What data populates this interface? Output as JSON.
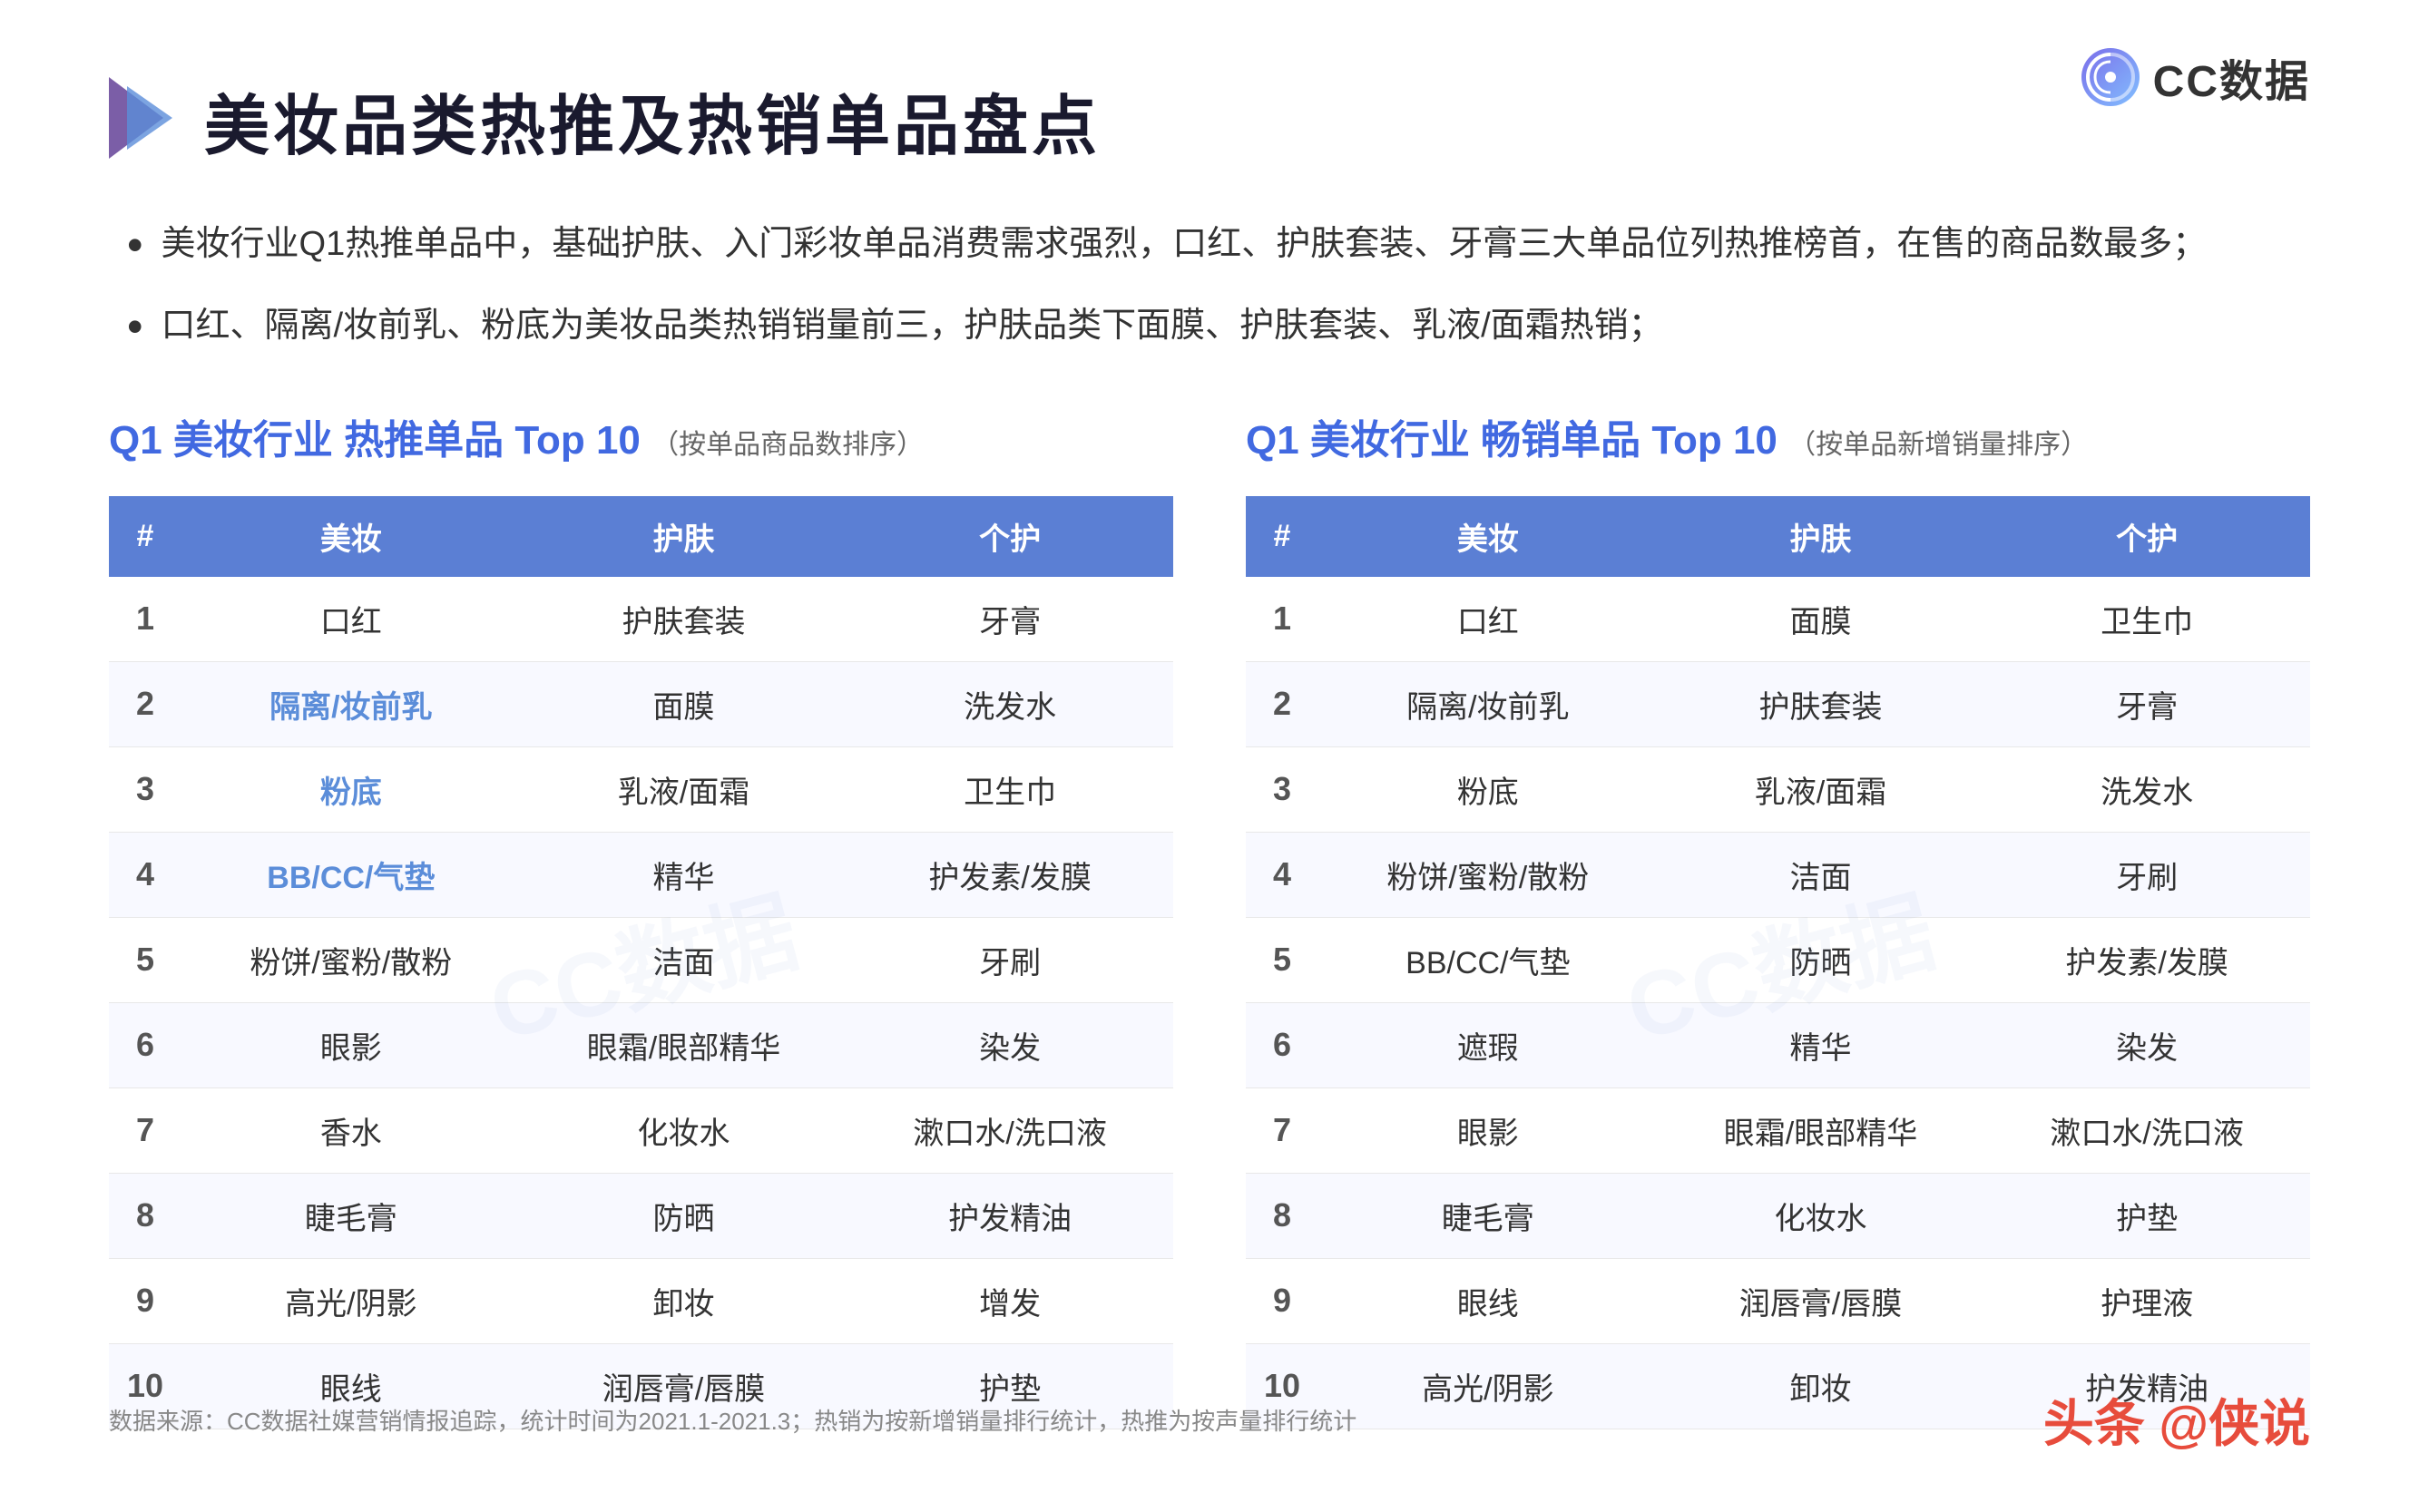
{
  "logo": {
    "text": "CC数据"
  },
  "title": {
    "main": "美妆品类热推及热销单品盘点"
  },
  "bullets": [
    "美妆行业Q1热推单品中，基础护肤、入门彩妆单品消费需求强烈，口红、护肤套装、牙膏三大单品位列热推榜首，在售的商品数最多；",
    "口红、隔离/妆前乳、粉底为美妆品类热销销量前三，护肤品类下面膜、护肤套装、乳液/面霜热销；"
  ],
  "left_table": {
    "title_prefix": "Q1 美妆行业 热推单品 Top 10",
    "title_suffix": "（按单品商品数排序）",
    "headers": [
      "#",
      "美妆",
      "护肤",
      "个护"
    ],
    "rows": [
      [
        "1",
        "口红",
        "护肤套装",
        "牙膏"
      ],
      [
        "2",
        "隔离/妆前乳",
        "面膜",
        "洗发水"
      ],
      [
        "3",
        "粉底",
        "乳液/面霜",
        "卫生巾"
      ],
      [
        "4",
        "BB/CC/气垫",
        "精华",
        "护发素/发膜"
      ],
      [
        "5",
        "粉饼/蜜粉/散粉",
        "洁面",
        "牙刷"
      ],
      [
        "6",
        "眼影",
        "眼霜/眼部精华",
        "染发"
      ],
      [
        "7",
        "香水",
        "化妆水",
        "漱口水/洗口液"
      ],
      [
        "8",
        "睫毛膏",
        "防晒",
        "护发精油"
      ],
      [
        "9",
        "高光/阴影",
        "卸妆",
        "增发"
      ],
      [
        "10",
        "眼线",
        "润唇膏/唇膜",
        "护垫"
      ]
    ],
    "highlighted": [
      [
        1,
        1
      ],
      [
        2,
        1
      ]
    ]
  },
  "right_table": {
    "title_prefix": "Q1 美妆行业 畅销单品 Top 10",
    "title_suffix": "（按单品新增销量排序）",
    "headers": [
      "#",
      "美妆",
      "护肤",
      "个护"
    ],
    "rows": [
      [
        "1",
        "口红",
        "面膜",
        "卫生巾"
      ],
      [
        "2",
        "隔离/妆前乳",
        "护肤套装",
        "牙膏"
      ],
      [
        "3",
        "粉底",
        "乳液/面霜",
        "洗发水"
      ],
      [
        "4",
        "粉饼/蜜粉/散粉",
        "洁面",
        "牙刷"
      ],
      [
        "5",
        "BB/CC/气垫",
        "防晒",
        "护发素/发膜"
      ],
      [
        "6",
        "遮瑕",
        "精华",
        "染发"
      ],
      [
        "7",
        "眼影",
        "眼霜/眼部精华",
        "漱口水/洗口液"
      ],
      [
        "8",
        "睫毛膏",
        "化妆水",
        "护垫"
      ],
      [
        "9",
        "眼线",
        "润唇膏/唇膜",
        "护理液"
      ],
      [
        "10",
        "高光/阴影",
        "卸妆",
        "护发精油"
      ]
    ]
  },
  "footer": {
    "source": "数据来源：CC数据社媒营销情报追踪，统计时间为2021.1-2021.3；热销为按新增销量排行统计，热推为按声量排行统计",
    "brand": "头条 @侠说"
  },
  "watermark": "CC数据"
}
